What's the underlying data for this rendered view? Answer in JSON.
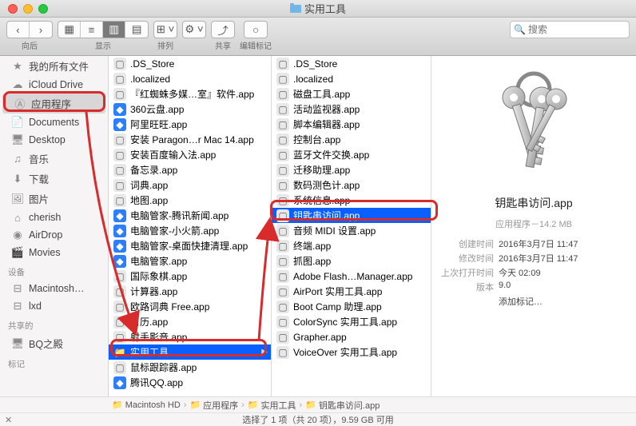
{
  "window": {
    "title": "实用工具"
  },
  "toolbar": {
    "nav_label": "向后",
    "view_label": "显示",
    "arrange_label": "排列",
    "action_label": "共享",
    "tags_label": "编辑标记",
    "search_placeholder": "搜索"
  },
  "sidebar": {
    "items1": [
      {
        "label": "我的所有文件",
        "icon": "star"
      },
      {
        "label": "iCloud Drive",
        "icon": "cloud"
      },
      {
        "label": "应用程序",
        "icon": "app",
        "selected": true
      },
      {
        "label": "Documents",
        "icon": "doc"
      },
      {
        "label": "Desktop",
        "icon": "desk"
      },
      {
        "label": "音乐",
        "icon": "music"
      },
      {
        "label": "下载",
        "icon": "down"
      },
      {
        "label": "图片",
        "icon": "pic"
      },
      {
        "label": "cherish",
        "icon": "home"
      },
      {
        "label": "AirDrop",
        "icon": "air"
      },
      {
        "label": "Movies",
        "icon": "movie"
      }
    ],
    "devices_header": "设备",
    "items2": [
      {
        "label": "Macintosh…",
        "icon": "disk"
      },
      {
        "label": "lxd",
        "icon": "disk"
      }
    ],
    "shared_header": "共享的",
    "items3": [
      {
        "label": "BQ之殿",
        "icon": "net"
      }
    ],
    "tags_header": "标记"
  },
  "col1": [
    {
      "name": ".DS_Store",
      "ico": "app"
    },
    {
      "name": ".localized",
      "ico": "app"
    },
    {
      "name": "『红蜘蛛多媒…室』软件.app",
      "ico": "app"
    },
    {
      "name": "360云盘.app",
      "ico": "blue"
    },
    {
      "name": "阿里旺旺.app",
      "ico": "blue"
    },
    {
      "name": "安装 Paragon…r Mac 14.app",
      "ico": "app"
    },
    {
      "name": "安装百度输入法.app",
      "ico": "app"
    },
    {
      "name": "备忘录.app",
      "ico": "app"
    },
    {
      "name": "词典.app",
      "ico": "app"
    },
    {
      "name": "地图.app",
      "ico": "app"
    },
    {
      "name": "电脑管家-腾讯新闻.app",
      "ico": "blue"
    },
    {
      "name": "电脑管家-小火箭.app",
      "ico": "blue"
    },
    {
      "name": "电脑管家-桌面快捷清理.app",
      "ico": "blue"
    },
    {
      "name": "电脑管家.app",
      "ico": "blue"
    },
    {
      "name": "国际象棋.app",
      "ico": "app"
    },
    {
      "name": "计算器.app",
      "ico": "app"
    },
    {
      "name": "欧路词典 Free.app",
      "ico": "app"
    },
    {
      "name": "日历.app",
      "ico": "app"
    },
    {
      "name": "射手影音.app",
      "ico": "app"
    },
    {
      "name": "实用工具",
      "ico": "folder",
      "arrow": true,
      "selected": true
    },
    {
      "name": "鼠标跟踪器.app",
      "ico": "app"
    },
    {
      "name": "腾讯QQ.app",
      "ico": "blue"
    }
  ],
  "col2": [
    {
      "name": ".DS_Store",
      "ico": "app"
    },
    {
      "name": ".localized",
      "ico": "app"
    },
    {
      "name": "磁盘工具.app",
      "ico": "app"
    },
    {
      "name": "活动监视器.app",
      "ico": "app"
    },
    {
      "name": "脚本编辑器.app",
      "ico": "app"
    },
    {
      "name": "控制台.app",
      "ico": "app"
    },
    {
      "name": "蓝牙文件交换.app",
      "ico": "app"
    },
    {
      "name": "迁移助理.app",
      "ico": "app"
    },
    {
      "name": "数码测色计.app",
      "ico": "app"
    },
    {
      "name": "系统信息.app",
      "ico": "app"
    },
    {
      "name": "钥匙串访问.app",
      "ico": "app",
      "selected": true
    },
    {
      "name": "音频 MIDI 设置.app",
      "ico": "app"
    },
    {
      "name": "终端.app",
      "ico": "app"
    },
    {
      "name": "抓图.app",
      "ico": "app"
    },
    {
      "name": "Adobe Flash…Manager.app",
      "ico": "app"
    },
    {
      "name": "AirPort 实用工具.app",
      "ico": "app"
    },
    {
      "name": "Boot Camp 助理.app",
      "ico": "app"
    },
    {
      "name": "ColorSync 实用工具.app",
      "ico": "app"
    },
    {
      "name": "Grapher.app",
      "ico": "app"
    },
    {
      "name": "VoiceOver 实用工具.app",
      "ico": "app"
    }
  ],
  "preview": {
    "name": "钥匙串访问.app",
    "kind_size": "应用程序－14.2 MB",
    "meta": [
      {
        "k": "创建时间",
        "v": "2016年3月7日 11:47"
      },
      {
        "k": "修改时间",
        "v": "2016年3月7日 11:47"
      },
      {
        "k": "上次打开时间",
        "v": "今天 02:09"
      },
      {
        "k": "版本",
        "v": "9.0"
      }
    ],
    "add_tag": "添加标记…"
  },
  "path": [
    "Macintosh HD",
    "应用程序",
    "实用工具",
    "钥匙串访问.app"
  ],
  "status": "选择了 1 项（共 20 项），9.59 GB 可用"
}
